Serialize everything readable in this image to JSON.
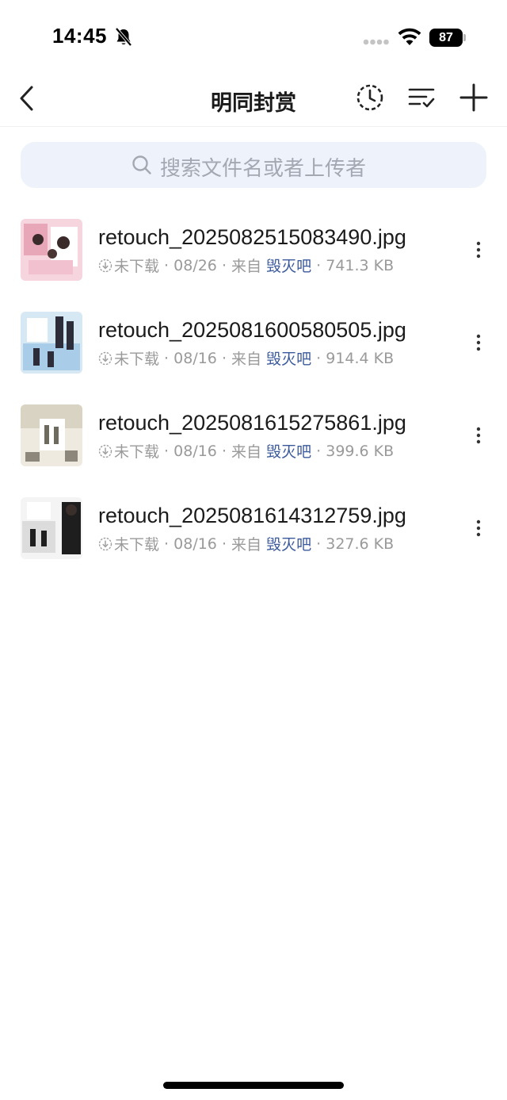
{
  "status_bar": {
    "time": "14:45",
    "battery": "87"
  },
  "nav": {
    "title": "明同封赏"
  },
  "search": {
    "placeholder": "搜索文件名或者上传者"
  },
  "files": [
    {
      "name": "retouch_2025082515083490.jpg",
      "status": "未下载",
      "date": "08/26",
      "from_label": "来自",
      "source": "毁灭吧",
      "size": "741.3 KB",
      "thumb_colors": [
        "#f6d5de",
        "#e8a7b8",
        "#ffffff",
        "#f2c1cf"
      ]
    },
    {
      "name": "retouch_2025081600580505.jpg",
      "status": "未下载",
      "date": "08/16",
      "from_label": "来自",
      "source": "毁灭吧",
      "size": "914.4 KB",
      "thumb_colors": [
        "#d7e8f5",
        "#a9cde8",
        "#ffffff",
        "#2c2c3a"
      ]
    },
    {
      "name": "retouch_2025081615275861.jpg",
      "status": "未下载",
      "date": "08/16",
      "from_label": "来自",
      "source": "毁灭吧",
      "size": "399.6 KB",
      "thumb_colors": [
        "#eeeae0",
        "#d9d3c4",
        "#ffffff",
        "#6d6a60"
      ]
    },
    {
      "name": "retouch_2025081614312759.jpg",
      "status": "未下载",
      "date": "08/16",
      "from_label": "来自",
      "source": "毁灭吧",
      "size": "327.6 KB",
      "thumb_colors": [
        "#f4f4f4",
        "#dcdcdc",
        "#ffffff",
        "#1e1e1e"
      ]
    }
  ],
  "colors": {
    "accent_link": "#3b5a9c",
    "search_bg": "#eef3fb",
    "meta_text": "#9a9a9a"
  },
  "icons": {
    "back": "chevron-left-icon",
    "history": "clock-icon",
    "sort": "sort-check-icon",
    "add": "plus-icon",
    "search": "search-icon",
    "more": "more-vertical-icon",
    "download_status": "download-circle-icon"
  }
}
